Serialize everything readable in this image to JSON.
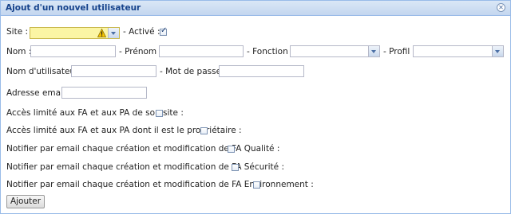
{
  "window": {
    "title": "Ajout d'un nouvel utilisateur",
    "close_icon": "close-icon"
  },
  "form": {
    "site_label": "Site :",
    "active_label": "- Activé :",
    "active_checked": true,
    "site_warning_icon": "warning-icon",
    "nom_label": "Nom :",
    "prenom_label": "- Prénom :",
    "fonction_label": "- Fonction :",
    "profil_label": "- Profil :",
    "username_label": "Nom d'utilisateur :",
    "password_label": "- Mot de passe :",
    "email_label": "Adresse email :",
    "checkboxes": [
      {
        "label": "Accès limité aux FA et aux PA de son site :",
        "checked": false
      },
      {
        "label": "Accès limité aux FA et aux PA dont il est le propriétaire :",
        "checked": false
      },
      {
        "label": "Notifier par email chaque création et modification de FA Qualité :",
        "checked": false
      },
      {
        "label": "Notifier par email chaque création et modification de FA Sécurité :",
        "checked": false
      },
      {
        "label": "Notifier par email chaque création et modification de FA Environnement :",
        "checked": false
      }
    ],
    "submit_label": "Ajouter"
  },
  "colors": {
    "title_bar": "#c3d6ef",
    "title_text": "#15428b",
    "invalid_field": "#fbf5a4"
  }
}
